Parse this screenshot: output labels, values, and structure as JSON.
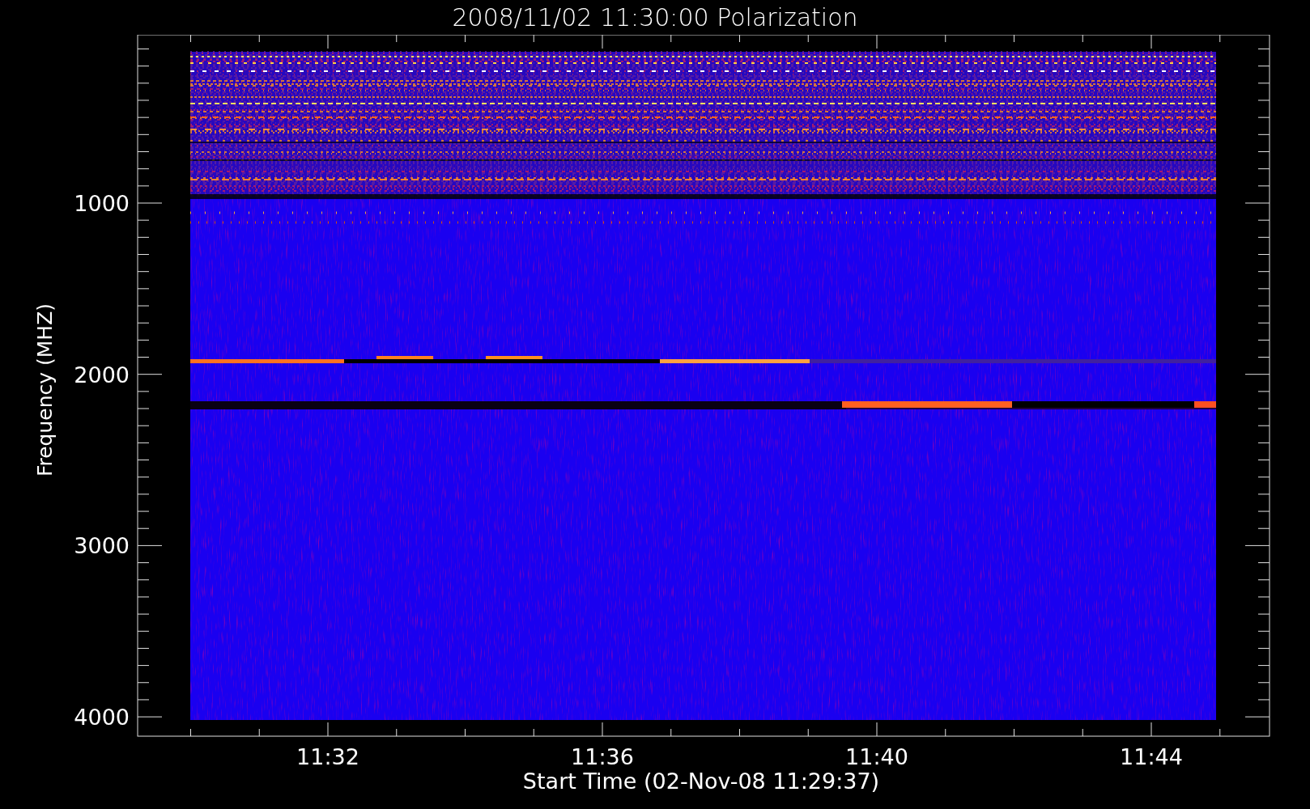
{
  "title": "2008/11/02 11:30:00 Polarization",
  "plot": {
    "ylabel": "Frequency (MHZ)",
    "xlabel": "Start Time (02-Nov-08 11:29:37)",
    "yticks": [
      "1000",
      "2000",
      "3000",
      "4000"
    ],
    "xticks": [
      "11:32",
      "11:36",
      "11:40",
      "11:44"
    ]
  }
}
